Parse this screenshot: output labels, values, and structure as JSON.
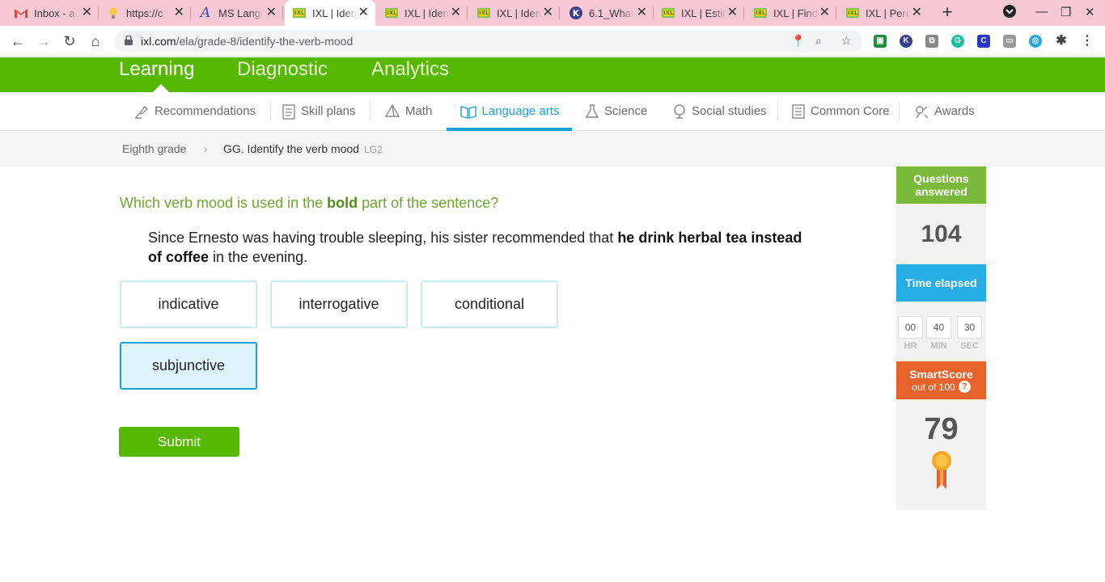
{
  "browser": {
    "tabs": [
      {
        "title": "Inbox - a",
        "icon": "gmail-icon"
      },
      {
        "title": "https://c",
        "icon": "bulb-icon"
      },
      {
        "title": "MS Langu",
        "icon": "ms-icon"
      },
      {
        "title": "IXL | Iden",
        "icon": "ixl-icon",
        "active": true
      },
      {
        "title": "IXL | Iden",
        "icon": "ixl-icon"
      },
      {
        "title": "IXL | Iden",
        "icon": "ixl-icon"
      },
      {
        "title": "6.1_What",
        "icon": "k-icon"
      },
      {
        "title": "IXL | Estir",
        "icon": "ixl-icon"
      },
      {
        "title": "IXL | Find",
        "icon": "ixl-icon"
      },
      {
        "title": "IXL | Perc",
        "icon": "ixl-icon"
      }
    ],
    "url_domain": "ixl.com",
    "url_path": "/ela/grade-8/identify-the-verb-mood"
  },
  "topnav": {
    "learning": "Learning",
    "diagnostic": "Diagnostic",
    "analytics": "Analytics"
  },
  "subnav": [
    {
      "label": "Recommendations"
    },
    {
      "label": "Skill plans"
    },
    {
      "label": "Math"
    },
    {
      "label": "Language arts"
    },
    {
      "label": "Science"
    },
    {
      "label": "Social studies"
    },
    {
      "label": "Common Core"
    },
    {
      "label": "Awards"
    }
  ],
  "breadcrumb": {
    "grade": "Eighth grade",
    "skill": "GG. Identify the verb mood",
    "code": "LG2"
  },
  "question": {
    "prompt_pre": "Which verb mood is used in the ",
    "prompt_bold": "bold",
    "prompt_post": " part of the sentence?",
    "sentence_pre": "Since Ernesto was having trouble sleeping, his sister recommended that ",
    "sentence_bold": "he drink herbal tea instead of coffee",
    "sentence_post": " in the evening."
  },
  "choices": [
    "indicative",
    "interrogative",
    "conditional",
    "subjunctive"
  ],
  "selected_choice": "subjunctive",
  "submit_label": "Submit",
  "sidebar": {
    "questions_label": "Questions answered",
    "questions_value": "104",
    "time_label": "Time elapsed",
    "time_hr": "00",
    "time_min": "40",
    "time_sec": "30",
    "hr_label": "HR",
    "min_label": "MIN",
    "sec_label": "SEC",
    "smartscore_label": "SmartScore",
    "smartscore_sub": "out of 100",
    "smartscore_value": "79"
  },
  "colors": {
    "ixl_green": "#56b800",
    "ixl_blue": "#1aa0d6",
    "smartscore_orange": "#e8622c"
  }
}
